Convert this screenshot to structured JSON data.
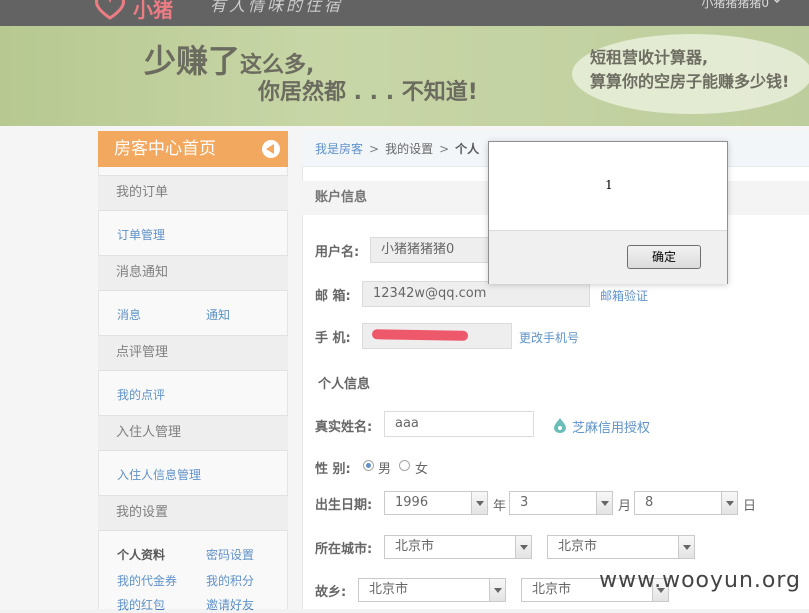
{
  "header": {
    "logo_text": "小猪",
    "slogan": "有人情味的住宿",
    "username": "小猪猪猪猪0"
  },
  "banner": {
    "line1_big": "少赚了",
    "line1_small": "这么多,",
    "line2": "你居然都 . . . 不知道!",
    "cloud_line1": "短租营收计算器,",
    "cloud_line2": "算算你的空房子能赚多少钱!"
  },
  "sidebar": {
    "home": "房客中心首页",
    "sections": {
      "orders": "我的订单",
      "messages": "消息通知",
      "reviews": "点评管理",
      "guests": "入住人管理",
      "settings": "我的设置"
    },
    "links": {
      "order_mgmt": "订单管理",
      "msg": "消息",
      "notice": "通知",
      "my_review": "我的点评",
      "guest_info": "入住人信息管理",
      "profile": "个人资料",
      "password": "密码设置",
      "vouchers": "我的代金券",
      "points": "我的积分",
      "red_packets": "我的红包",
      "invite": "邀请好友"
    }
  },
  "breadcrumb": {
    "root": "我是房客",
    "sep": ">",
    "level2": "我的设置",
    "current": "个人"
  },
  "account": {
    "title": "账户信息",
    "username_label": "用户名:",
    "username_value": "小猪猪猪猪0",
    "email_label": "邮 箱:",
    "email_value": "12342w@qq.com",
    "email_verify": "邮箱验证",
    "phone_label": "手 机:",
    "phone_change": "更改手机号"
  },
  "personal": {
    "title": "个人信息",
    "realname_label": "真实姓名:",
    "realname_value": "aaa",
    "sesame": "芝麻信用授权",
    "gender_label": "性 别:",
    "gender_male": "男",
    "gender_female": "女",
    "gender_selected": "男",
    "birth_label": "出生日期:",
    "birth_year": "1996",
    "year_unit": "年",
    "birth_month": "3",
    "month_unit": "月",
    "birth_day": "8",
    "day_unit": "日",
    "city_label": "所在城市:",
    "city_province": "北京市",
    "city_city": "北京市",
    "hometown_label": "故乡:",
    "hometown_province": "北京市",
    "hometown_city": "北京市"
  },
  "dialog": {
    "message": "1",
    "ok_label": "确定"
  },
  "watermark": "www.wooyun.org",
  "colors": {
    "accent_orange": "#ef8b2a",
    "link_blue": "#2a6eb6",
    "banner_green": "#a9bd7c"
  }
}
